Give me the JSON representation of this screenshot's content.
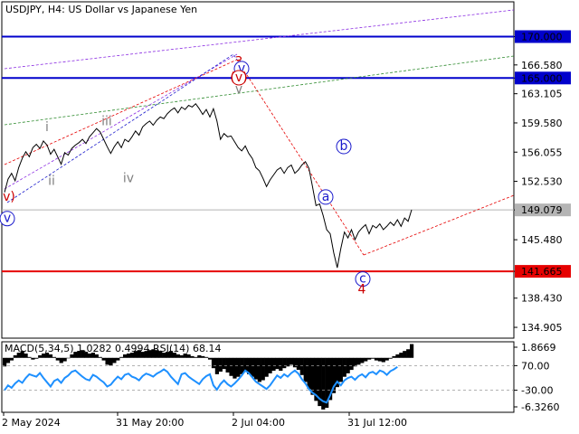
{
  "header": {
    "title": "USDJPY, H4:  US Dollar vs Japanese Yen"
  },
  "colors": {
    "price": "#000000",
    "blue_level": "#0000cc",
    "red_level": "#e60000",
    "current_price": "#b4b4b4",
    "green_dash": "#2e8b2e",
    "purple_dash": "#8a2be2",
    "red_dash": "#e60000",
    "wave_blue": "#1a1acc",
    "wave_red": "#cc0000",
    "wave_gray": "#808080",
    "rsi": "#1e90ff",
    "macd": "#000000"
  },
  "chart_data": {
    "type": "line",
    "symbol": "USDJPY",
    "timeframe": "H4",
    "ylim": [
      133.6,
      174.2
    ],
    "price_ticks": [
      "170.000",
      "166.580",
      "165.000",
      "163.105",
      "159.580",
      "156.055",
      "152.530",
      "149.079",
      "145.480",
      "141.665",
      "138.430",
      "134.905"
    ],
    "price_tick_values": [
      170.0,
      166.58,
      165.0,
      163.105,
      159.58,
      156.055,
      152.53,
      149.079,
      145.48,
      141.665,
      138.43,
      134.905
    ],
    "highlighted_ticks": [
      {
        "label": "170.000",
        "value": 170.0,
        "style": "blue"
      },
      {
        "label": "165.000",
        "value": 165.0,
        "style": "blue"
      },
      {
        "label": "149.079",
        "value": 149.079,
        "style": "current"
      },
      {
        "label": "141.665",
        "value": 141.665,
        "style": "red"
      }
    ],
    "levels": [
      {
        "value": 170.0,
        "color": "blue"
      },
      {
        "value": 165.0,
        "color": "blue"
      },
      {
        "value": 141.665,
        "color": "red"
      },
      {
        "value": 149.079,
        "color": "current"
      }
    ],
    "time_labels": [
      "2 May 2024",
      "31 May 20:00",
      "2 Jul 04:00",
      "31 Jul 12:00"
    ],
    "series": [
      {
        "values": [
          151.2,
          152.8,
          153.5,
          152.6,
          154.2,
          155.3,
          156.1,
          155.5,
          156.6,
          157.0,
          156.5,
          157.4,
          156.9,
          155.8,
          156.4,
          155.5,
          154.6,
          156.0,
          155.7,
          156.5,
          156.9,
          157.2,
          157.6,
          157.1,
          157.9,
          158.4,
          158.9,
          158.5,
          157.6,
          156.7,
          155.9,
          156.7,
          157.3,
          156.6,
          157.6,
          157.3,
          157.9,
          158.6,
          158.1,
          159.1,
          159.5,
          159.8,
          159.3,
          159.9,
          160.3,
          160.1,
          160.7,
          161.1,
          161.4,
          160.8,
          161.5,
          161.2,
          161.7,
          161.5,
          161.9,
          161.3,
          160.6,
          161.2,
          160.3,
          161.3,
          159.8,
          157.6,
          158.3,
          157.9,
          158.0,
          157.3,
          156.6,
          156.2,
          156.8,
          155.9,
          155.3,
          154.2,
          153.8,
          152.9,
          151.9,
          152.7,
          153.3,
          153.9,
          154.2,
          153.5,
          154.2,
          154.5,
          153.5,
          153.9,
          154.5,
          154.9,
          154.1,
          151.9,
          149.6,
          149.8,
          148.4,
          146.7,
          146.2,
          143.9,
          142.1,
          144.4,
          146.4,
          145.7,
          146.7,
          145.5,
          146.4,
          146.9,
          147.3,
          146.2,
          147.2,
          146.9,
          147.4,
          146.7,
          147.1,
          147.6,
          147.2,
          147.9,
          147.1,
          148.1,
          147.7,
          149.1
        ]
      }
    ],
    "annotations": {
      "waves": [
        {
          "label": "v",
          "value": 147.6,
          "style": "circle-blue"
        },
        {
          "label": "v)",
          "value": 150.2,
          "style": "red"
        },
        {
          "label": "i",
          "value": 158.6,
          "style": "gray"
        },
        {
          "label": "ii",
          "value": 152.1,
          "style": "gray"
        },
        {
          "label": "iii",
          "value": 159.3,
          "style": "gray"
        },
        {
          "label": "iv",
          "value": 152.4,
          "style": "gray"
        },
        {
          "label": "3",
          "value": 166.5,
          "style": "red"
        },
        {
          "label": "v",
          "value": 165.7,
          "style": "circle-blue"
        },
        {
          "label": "(v)",
          "value": 164.6,
          "style": "red-paren"
        },
        {
          "label": "v",
          "value": 163.2,
          "style": "gray"
        },
        {
          "label": "a",
          "value": 150.2,
          "style": "circle-blue"
        },
        {
          "label": "b",
          "value": 156.3,
          "style": "circle-blue"
        },
        {
          "label": "c",
          "value": 140.3,
          "style": "circle-blue"
        },
        {
          "label": "4",
          "value": 139.0,
          "style": "red"
        }
      ]
    },
    "indicator": {
      "title": "MACD(5,34,5) 1.0282 0.4994 RSI(14) 68.14",
      "ticks": [
        "1.8669",
        "70.00",
        "-30.00",
        "-6.3260"
      ],
      "rsi_levels": [
        70,
        30
      ],
      "rsi": [
        30,
        38,
        34,
        41,
        46,
        42,
        50,
        56,
        54,
        52,
        58,
        50,
        43,
        36,
        45,
        48,
        42,
        50,
        54,
        60,
        62,
        57,
        52,
        48,
        46,
        55,
        52,
        47,
        43,
        36,
        39,
        46,
        52,
        48,
        55,
        57,
        52,
        50,
        46,
        53,
        57,
        55,
        52,
        57,
        60,
        64,
        60,
        52,
        46,
        40,
        56,
        58,
        52,
        48,
        44,
        40,
        48,
        53,
        56,
        38,
        31,
        40,
        46,
        40,
        36,
        41,
        47,
        54,
        62,
        58,
        51,
        44,
        40,
        36,
        32,
        38,
        46,
        54,
        50,
        56,
        52,
        58,
        62,
        57,
        48,
        41,
        32,
        26,
        22,
        16,
        12,
        10,
        22,
        36,
        44,
        38,
        46,
        50,
        52,
        47,
        53,
        56,
        51,
        58,
        60,
        56,
        62,
        60,
        55,
        61,
        64,
        68
      ],
      "macd": [
        -1.0,
        -0.6,
        -0.3,
        0.3,
        0.6,
        0.8,
        0.5,
        0.1,
        -0.2,
        -0.1,
        0.3,
        0.5,
        0.6,
        0.4,
        0.1,
        -0.3,
        -0.6,
        -0.4,
        0.0,
        0.4,
        0.7,
        0.8,
        0.9,
        0.7,
        0.5,
        0.6,
        0.4,
        0.1,
        -0.3,
        -0.8,
        -0.9,
        -0.6,
        -0.3,
        0.1,
        0.4,
        0.5,
        0.6,
        0.8,
        0.9,
        0.7,
        0.8,
        0.9,
        1.0,
        0.9,
        0.8,
        0.6,
        0.7,
        0.8,
        0.6,
        0.4,
        0.3,
        0.5,
        0.4,
        0.2,
        0.1,
        0.3,
        0.2,
        0.1,
        -0.2,
        -1.2,
        -1.9,
        -1.6,
        -1.3,
        -1.7,
        -2.1,
        -2.4,
        -2.2,
        -1.9,
        -1.6,
        -1.9,
        -2.2,
        -2.5,
        -2.8,
        -2.6,
        -2.2,
        -1.8,
        -1.5,
        -1.3,
        -1.5,
        -1.2,
        -1.0,
        -0.8,
        -1.1,
        -1.4,
        -2.0,
        -2.8,
        -3.6,
        -4.3,
        -5.0,
        -5.6,
        -6.0,
        -5.8,
        -4.9,
        -4.1,
        -3.4,
        -2.8,
        -2.2,
        -1.8,
        -1.4,
        -1.0,
        -0.8,
        -0.6,
        -0.4,
        -0.2,
        -0.1,
        -0.3,
        -0.4,
        -0.5,
        -0.3,
        -0.1,
        0.2,
        0.4,
        0.6,
        0.8,
        1.0,
        1.6
      ]
    }
  }
}
